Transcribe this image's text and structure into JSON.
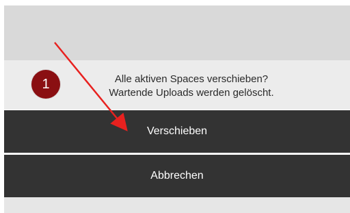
{
  "dialog": {
    "message_line_1": "Alle aktiven Spaces verschieben?",
    "message_line_2": "Wartende Uploads werden gelöscht.",
    "move_button_label": "Verschieben",
    "cancel_button_label": "Abbrechen"
  },
  "annotation": {
    "step_number": "1",
    "badge_color": "#8a0f12",
    "arrow_color": "#e8211f"
  },
  "colors": {
    "button_background": "#333333",
    "message_background": "#ececec",
    "top_band_background": "#d9d9d9"
  }
}
